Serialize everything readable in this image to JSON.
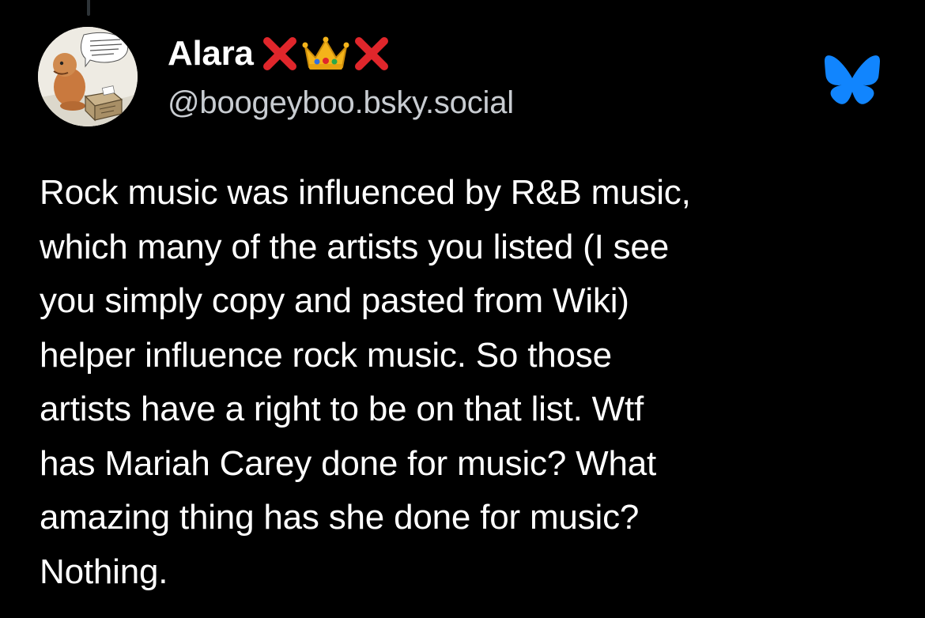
{
  "post": {
    "author": {
      "display_name": "Alara",
      "name_emojis": [
        "cross-mark",
        "crown",
        "cross-mark"
      ],
      "handle": "@boogeyboo.bsky.social",
      "avatar": "cartoon-avatar"
    },
    "platform_icon": "bluesky-butterfly-icon",
    "text": "Rock music was influenced by R&B music,\nwhich many of the artists you listed (I see\nyou simply copy and pasted from Wiki)\nhelper influence rock music. So those\nartists have a right to be on that list. Wtf\nhas Mariah Carey done for music? What\namazing thing has she done for music?\nNothing."
  },
  "colors": {
    "background": "#000000",
    "text": "#ffffff",
    "handle": "#c8ccd1",
    "bluesky_blue": "#1185fe",
    "cross_red": "#e0262b",
    "crown_gold": "#f4b41a"
  }
}
